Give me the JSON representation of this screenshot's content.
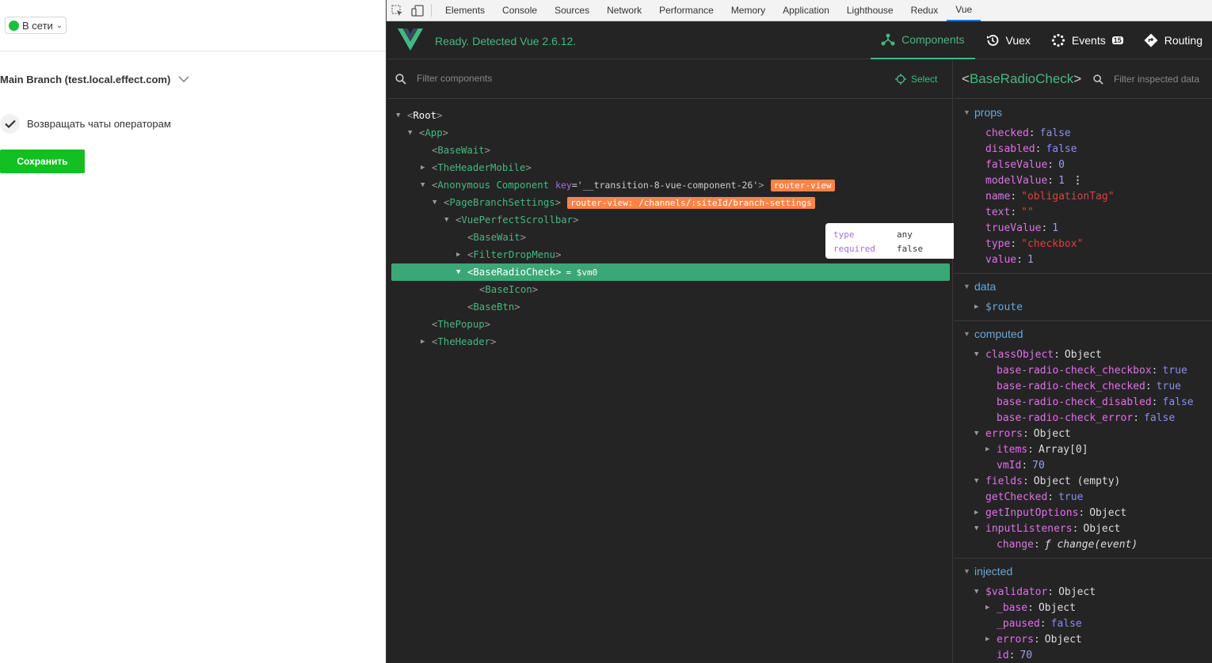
{
  "app": {
    "status_label": "В сети",
    "branch_label": "Main Branch (test.local.effect.com)",
    "checkbox_label": "Возвращать чаты операторам",
    "save_label": "Сохранить"
  },
  "devtools": {
    "tabs": [
      "Elements",
      "Console",
      "Sources",
      "Network",
      "Performance",
      "Memory",
      "Application",
      "Lighthouse",
      "Redux",
      "Vue"
    ],
    "active_tab": "Vue"
  },
  "vue": {
    "ready_text": "Ready. Detected Vue 2.6.12.",
    "nav": {
      "components": "Components",
      "vuex": "Vuex",
      "events": "Events",
      "events_count": "15",
      "routing": "Routing"
    },
    "filter_placeholder": "Filter components",
    "select_label": "Select",
    "tree": [
      {
        "name": "Root"
      },
      {
        "name": "App"
      },
      {
        "name": "BaseWait"
      },
      {
        "name": "TheHeaderMobile"
      },
      {
        "name": "Anonymous Component",
        "key_attr": "key",
        "key_value": "'__transition-8-vue-component-26'",
        "badge": "router-view"
      },
      {
        "name": "PageBranchSettings",
        "badge": "router-view: /channels/:siteId/branch-settings"
      },
      {
        "name": "VuePerfectScrollbar"
      },
      {
        "name": "BaseWait"
      },
      {
        "name": "FilterDropMenu"
      },
      {
        "name": "BaseRadioCheck",
        "vm": "= $vm0"
      },
      {
        "name": "BaseIcon"
      },
      {
        "name": "BaseBtn"
      },
      {
        "name": "ThePopup"
      },
      {
        "name": "TheHeader"
      }
    ],
    "tooltip": {
      "type_key": "type",
      "type_val": "any",
      "req_key": "required",
      "req_val": "false"
    },
    "inspector": {
      "title": "BaseRadioCheck",
      "filter_placeholder": "Filter inspected data",
      "sections": {
        "props": "props",
        "data": "data",
        "computed": "computed",
        "injected": "injected"
      },
      "props": [
        {
          "k": "checked",
          "v": "false",
          "t": "bool"
        },
        {
          "k": "disabled",
          "v": "false",
          "t": "bool"
        },
        {
          "k": "falseValue",
          "v": "0",
          "t": "num"
        },
        {
          "k": "modelValue",
          "v": "1",
          "t": "num"
        },
        {
          "k": "name",
          "v": "\"obligationTag\"",
          "t": "str"
        },
        {
          "k": "text",
          "v": "\"\"",
          "t": "str"
        },
        {
          "k": "trueValue",
          "v": "1",
          "t": "num"
        },
        {
          "k": "type",
          "v": "\"checkbox\"",
          "t": "str"
        },
        {
          "k": "value",
          "v": "1",
          "t": "num"
        }
      ],
      "data": [
        {
          "k": "$route",
          "v": "",
          "t": "obj"
        }
      ],
      "computed": [
        {
          "k": "classObject",
          "v": "Object",
          "t": "obj"
        },
        {
          "k": "base-radio-check_checkbox",
          "v": "true",
          "t": "bool"
        },
        {
          "k": "base-radio-check_checked",
          "v": "true",
          "t": "bool"
        },
        {
          "k": "base-radio-check_disabled",
          "v": "false",
          "t": "bool"
        },
        {
          "k": "base-radio-check_error",
          "v": "false",
          "t": "bool"
        },
        {
          "k": "errors",
          "v": "Object",
          "t": "obj"
        },
        {
          "k": "items",
          "v": "Array[0]",
          "t": "obj"
        },
        {
          "k": "vmId",
          "v": "70",
          "t": "num"
        },
        {
          "k": "fields",
          "v": "Object (empty)",
          "t": "obj"
        },
        {
          "k": "getChecked",
          "v": "true",
          "t": "bool"
        },
        {
          "k": "getInputOptions",
          "v": "Object",
          "t": "obj"
        },
        {
          "k": "inputListeners",
          "v": "Object",
          "t": "obj"
        },
        {
          "k": "change",
          "v": "ƒ change(event)",
          "t": "fn"
        }
      ],
      "injected": [
        {
          "k": "$validator",
          "v": "Object",
          "t": "obj"
        },
        {
          "k": "_base",
          "v": "Object",
          "t": "obj"
        },
        {
          "k": "_paused",
          "v": "false",
          "t": "bool"
        },
        {
          "k": "errors",
          "v": "Object",
          "t": "obj"
        },
        {
          "k": "id",
          "v": "70",
          "t": "num"
        }
      ]
    }
  }
}
